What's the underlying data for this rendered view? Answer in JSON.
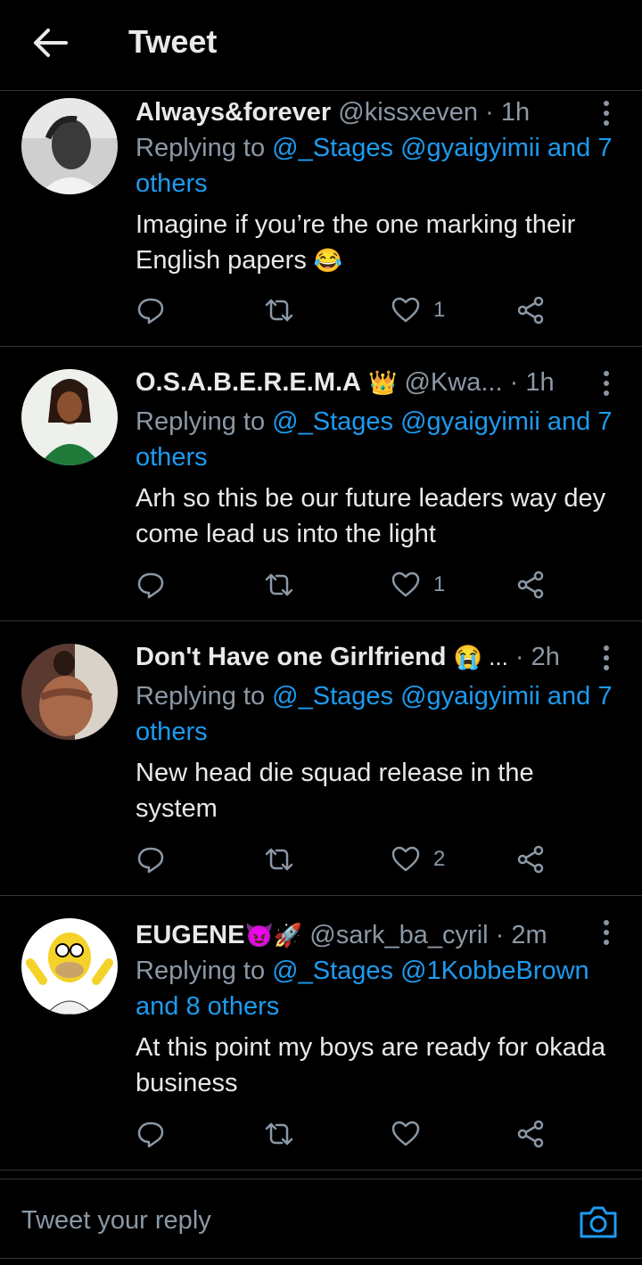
{
  "header": {
    "title": "Tweet",
    "back_icon": "arrow-left-icon"
  },
  "tweets": [
    {
      "name": "Always&forever",
      "name_emojis": "",
      "handle": "@kissxeven",
      "time": "1h",
      "replying_prefix": "Replying to",
      "replying_links": "@_Stages @gyaigyimii and 7 others",
      "text": "Imagine if you’re the one marking their English papers",
      "text_emoji": "😂",
      "like_count": "1"
    },
    {
      "name": "O.S.A.B.E.R.E.M.A",
      "name_emojis": "👑",
      "handle": "@Kwa...",
      "time": "1h",
      "replying_prefix": "Replying to",
      "replying_links": "@_Stages @gyaigyimii and 7 others",
      "text": "Arh so this be our future leaders way dey come lead us into the light",
      "text_emoji": "",
      "like_count": "1"
    },
    {
      "name": "Don't Have one Girlfriend",
      "name_emojis": "😭 ...",
      "handle": "",
      "time": "2h",
      "replying_prefix": "Replying to",
      "replying_links": "@_Stages @gyaigyimii and 7 others",
      "text": "New head die squad release in the system",
      "text_emoji": "",
      "like_count": "2"
    },
    {
      "name": "EUGENE",
      "name_emojis": "😈🚀",
      "handle": "@sark_ba_cyril",
      "time": "2m",
      "replying_prefix": "Replying to",
      "replying_links": "@_Stages @1KobbeBrown and 8 others",
      "text": "At this point my boys are ready for okada business",
      "text_emoji": "",
      "like_count": ""
    }
  ],
  "composer": {
    "placeholder": "Tweet your reply",
    "camera_icon": "camera-icon"
  },
  "colors": {
    "background": "#000000",
    "text": "#e7e9ea",
    "muted": "#8b98a5",
    "link": "#1d9bf0",
    "divider": "#2f3336"
  }
}
